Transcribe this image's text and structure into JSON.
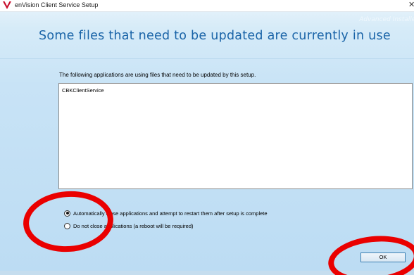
{
  "window": {
    "title": "enVision Client Service Setup",
    "brand": "Advanced Installer"
  },
  "dialog": {
    "heading": "Some files that need to be updated are currently in use",
    "description": "The following applications are using files that need to be updated by this setup.",
    "applications": [
      "CBKClientService"
    ],
    "options": [
      {
        "label": "Automatically close applications and attempt to restart them after setup is complete",
        "selected": true
      },
      {
        "label": "Do not close applications (a reboot will be required)",
        "selected": false
      }
    ],
    "ok_label": "OK"
  },
  "colors": {
    "heading": "#1a64a8",
    "annotation": "#ea0000",
    "logo": "#c8102e"
  },
  "icons": {
    "app_icon": "envision-logo-icon",
    "close_icon": "close-icon"
  }
}
